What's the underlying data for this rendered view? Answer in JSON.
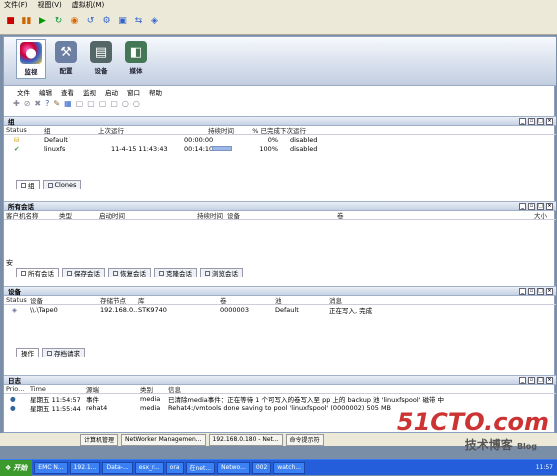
{
  "vm_menu": [
    "文件(F)",
    "视图(V)",
    "虚拟机(M)"
  ],
  "vm_toolbar_icons": [
    "stop-icon",
    "pause-icon",
    "play-icon",
    "refresh-icon",
    "snapshot-icon",
    "revert-icon",
    "manage-icon",
    "fullscreen-icon",
    "quick-switch-icon",
    "console-icon"
  ],
  "big_tools": [
    {
      "label": "监视",
      "icon": "monitor-icon"
    },
    {
      "label": "配置",
      "icon": "config-icon"
    },
    {
      "label": "设备",
      "icon": "devices-icon"
    },
    {
      "label": "媒体",
      "icon": "media-icon"
    }
  ],
  "app_menu": [
    "文件",
    "编辑",
    "查看",
    "监视",
    "启动",
    "窗口",
    "帮助"
  ],
  "groups_panel": {
    "title": "组",
    "columns": [
      "Status",
      "组",
      "上次运行",
      "持续时间",
      "% 已完成",
      "下次运行"
    ],
    "rows": [
      {
        "name": "Default",
        "last": "",
        "duration": "00:00:00",
        "pct": "0%",
        "pct_value": 0,
        "next": "disabled"
      },
      {
        "name": "linuxfs",
        "last": "11-4-15 11:43:43",
        "duration": "00:14:10",
        "pct": "100%",
        "pct_value": 100,
        "next": "disabled"
      }
    ],
    "tabs": [
      "组",
      "Clones"
    ]
  },
  "sessions_panel": {
    "title": "所有会话",
    "columns": [
      "客户机名称",
      "类型",
      "启动时间",
      "持续时间",
      "设备",
      "卷",
      "大小"
    ],
    "tabs": [
      "所有会话",
      "保存会话",
      "恢复会话",
      "克隆会话",
      "浏览会话"
    ],
    "side_label": "安"
  },
  "devices_panel": {
    "title": "设备",
    "columns": [
      "Status",
      "设备",
      "存储节点",
      "库",
      "卷",
      "池",
      "消息"
    ],
    "rows": [
      {
        "device": "\\\\.\\Tape0",
        "node": "192.168.0...",
        "lib": "STK9740",
        "volume": "0000003",
        "pool": "Default",
        "msg": "正在写入, 完成"
      }
    ],
    "tabs": [
      "操作",
      "存档请求"
    ]
  },
  "log_panel": {
    "title": "日志",
    "columns": [
      "Prio...",
      "Time",
      "源端",
      "类别",
      "信息"
    ],
    "rows": [
      {
        "time": "星期五 11:54:57",
        "src": "事件",
        "cat": "media",
        "info": "已清除media事件：正在等待 1 个可写入的卷写入至 pp 上的 backup 池 'linuxfspool' 磁带 中"
      },
      {
        "time": "星期五 11:55:44",
        "src": "rehat4",
        "cat": "media",
        "info": "Rehat4:/vmtools done saving to pool 'linuxfspool' (0000002) 505 MB"
      }
    ]
  },
  "vm_tabs": [
    "计算机管理",
    "NetWorker Managemen...",
    "192.168.0.180 - Net...",
    "命令提示符"
  ],
  "taskbar": {
    "start": "开始",
    "items": [
      "EMC N...",
      "192.1...",
      "Data-...",
      "esx_r...",
      "ora",
      "在net...",
      "Netwo...",
      "002",
      "watch..."
    ],
    "clock": "11:57"
  },
  "watermark": {
    "line1": "51CTO.com",
    "line2": "技术博客",
    "line3": "Blog"
  },
  "colors": {
    "panel_header": "#c6d2e4",
    "taskbar": "#245edb",
    "watermark": "#cc3333"
  }
}
